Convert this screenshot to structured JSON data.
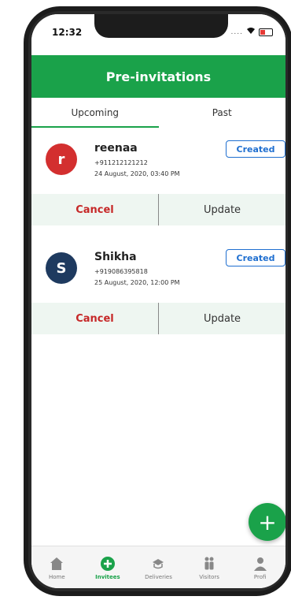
{
  "status_bar": {
    "time": "12:32",
    "signal": "....",
    "wifi": "wifi-icon",
    "battery": "battery-icon"
  },
  "header": {
    "title": "Pre-invitations"
  },
  "tabs": [
    {
      "label": "Upcoming",
      "active": true
    },
    {
      "label": "Past",
      "active": false
    }
  ],
  "invitations": [
    {
      "initial": "r",
      "avatar_color": "#d32f2f",
      "name": "reenaa",
      "phone": "+911212121212",
      "datetime": "24 August, 2020, 03:40 PM",
      "status": "Created",
      "cancel_label": "Cancel",
      "update_label": "Update"
    },
    {
      "initial": "S",
      "avatar_color": "#1e3a5f",
      "name": "Shikha",
      "phone": "+919086395818",
      "datetime": "25 August, 2020, 12:00 PM",
      "status": "Created",
      "cancel_label": "Cancel",
      "update_label": "Update"
    }
  ],
  "fab": {
    "label": "+"
  },
  "bottom_nav": [
    {
      "label": "Home",
      "icon": "home-icon",
      "active": false
    },
    {
      "label": "Invitees",
      "icon": "add-circle-icon",
      "active": true
    },
    {
      "label": "Deliveries",
      "icon": "delivery-icon",
      "active": false
    },
    {
      "label": "Visitors",
      "icon": "visitors-icon",
      "active": false
    },
    {
      "label": "Profi",
      "icon": "profile-icon",
      "active": false
    }
  ],
  "colors": {
    "primary": "#1aa24a",
    "cancel": "#c62828",
    "badge": "#1f6fd0"
  }
}
